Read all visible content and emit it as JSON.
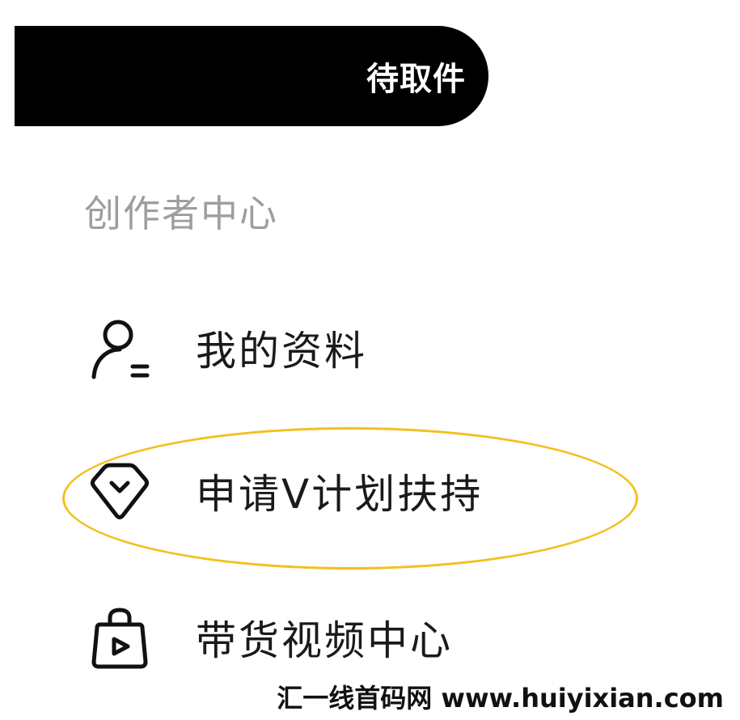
{
  "top_button": {
    "label": "待取件"
  },
  "section": {
    "title": "创作者中心"
  },
  "menu": {
    "items": [
      {
        "label": "我的资料",
        "icon": "user-profile-icon"
      },
      {
        "label": "申请V计划扶持",
        "icon": "diamond-badge-icon"
      },
      {
        "label": "带货视频中心",
        "icon": "shopping-bag-play-icon"
      }
    ]
  },
  "annotation": {
    "highlight_color": "#f2c01d"
  },
  "watermark": {
    "text": "汇一线首码网 www.huiyixian.com"
  }
}
